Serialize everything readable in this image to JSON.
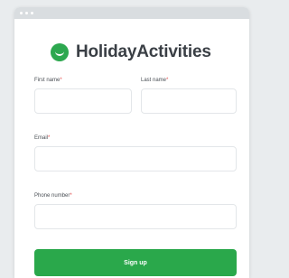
{
  "brand": {
    "name": "HolidayActivities",
    "logo": "smile-logo",
    "accent_color": "#2da84f"
  },
  "form": {
    "first_name": {
      "label": "First name",
      "required_mark": "*",
      "value": "",
      "placeholder": ""
    },
    "last_name": {
      "label": "Last name",
      "required_mark": "*",
      "value": "",
      "placeholder": ""
    },
    "email": {
      "label": "Email",
      "required_mark": "*",
      "value": "",
      "placeholder": ""
    },
    "phone": {
      "label": "Phone number",
      "required_mark": "*",
      "value": "",
      "placeholder": ""
    },
    "submit_label": "Sign up",
    "submit_color": "#2aa84b"
  }
}
